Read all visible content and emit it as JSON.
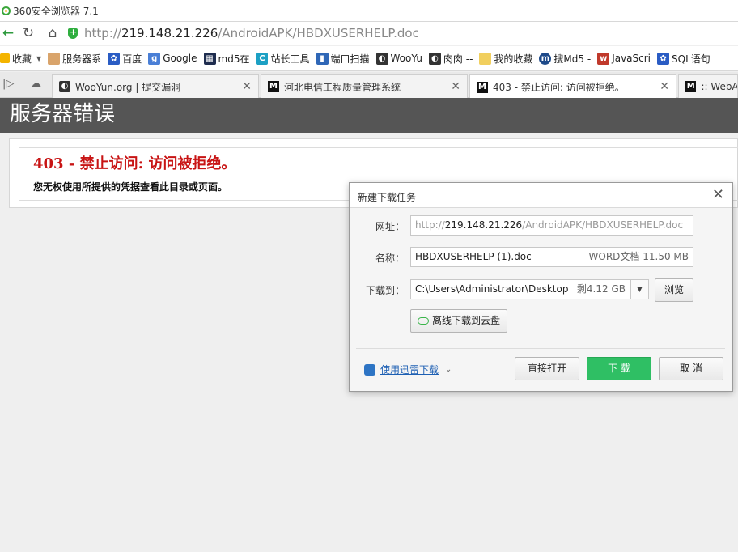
{
  "window": {
    "title": "360安全浏览器 7.1"
  },
  "nav": {
    "back_icon": "back-arrow-icon",
    "reload_icon": "reload-icon",
    "home_icon": "home-icon",
    "url_scheme": "http://",
    "url_host": "219.148.21.226",
    "url_path": "/AndroidAPK/HBDXUSERHELP.doc"
  },
  "bookmarks": [
    {
      "label": "收藏"
    },
    {
      "label": "服务器系"
    },
    {
      "label": "百度"
    },
    {
      "label": "Google"
    },
    {
      "label": "md5在"
    },
    {
      "label": "站长工具"
    },
    {
      "label": "端口扫描"
    },
    {
      "label": "WooYu"
    },
    {
      "label": "肉肉 --"
    },
    {
      "label": "我的收藏"
    },
    {
      "label": "搜Md5 -"
    },
    {
      "label": "JavaScri"
    },
    {
      "label": "SQL语句"
    }
  ],
  "tabs": [
    {
      "label": "WooYun.org | 提交漏洞"
    },
    {
      "label": "河北电信工程质量管理系统"
    },
    {
      "label": "403 - 禁止访问: 访问被拒绝。"
    },
    {
      "label": ":: WebA"
    }
  ],
  "page": {
    "header": "服务器错误",
    "error_title": "403 - 禁止访问: 访问被拒绝。",
    "error_desc": "您无权使用所提供的凭据查看此目录或页面。"
  },
  "dialog": {
    "title": "新建下载任务",
    "url_label": "网址：",
    "url_prefix": "http://",
    "url_host": "219.148.21.226",
    "url_path": "/AndroidAPK/HBDXUSERHELP.doc",
    "name_label": "名称：",
    "name_value": "HBDXUSERHELP (1).doc",
    "name_hint": "WORD文档 11.50 MB",
    "path_label": "下载到：",
    "path_value": "C:\\Users\\Administrator\\Desktop",
    "path_hint": "剩4.12 GB",
    "browse_label": "浏览",
    "cloud_label": "离线下载到云盘",
    "xunlei_label": "使用迅雷下载",
    "open_label": "直接打开",
    "download_label": "下 载",
    "cancel_label": "取 消"
  }
}
